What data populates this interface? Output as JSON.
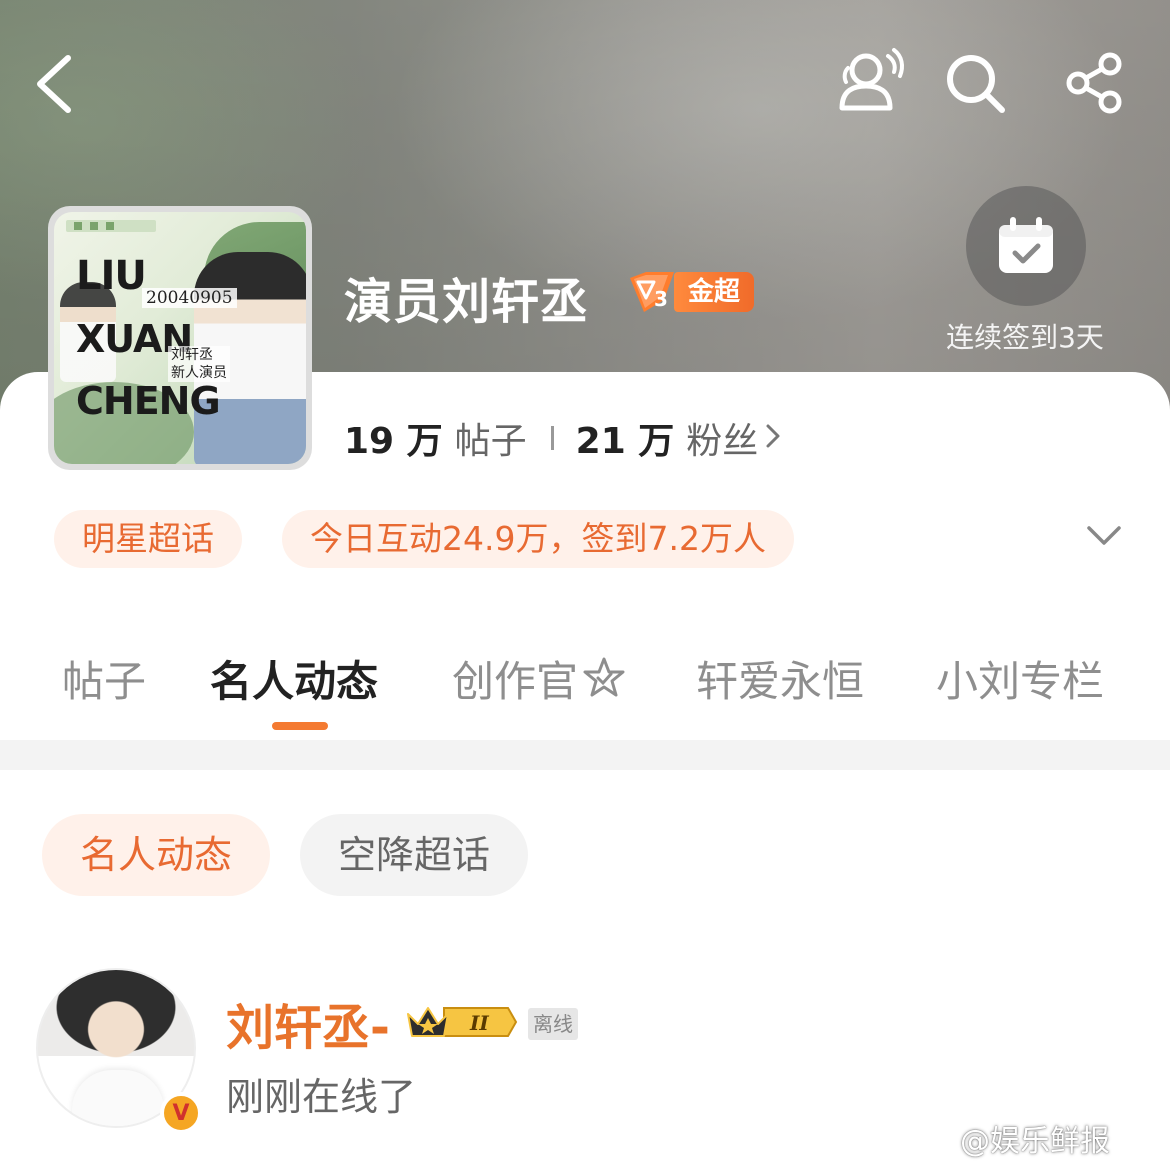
{
  "header": {
    "back_icon": "back-arrow-icon",
    "people_icon": "people-broadcast-icon",
    "search_icon": "search-icon",
    "share_icon": "share-icon"
  },
  "checkin": {
    "icon": "calendar-check-icon",
    "text": "连续签到3天"
  },
  "cover": {
    "line1": "LIU",
    "line2": "XUAN",
    "line3": "CHENG",
    "date": "20040905",
    "sub1": "刘轩丞",
    "sub2": "新人演员"
  },
  "community": {
    "title": "演员刘轩丞",
    "level_number": "3",
    "level_label": "金超",
    "posts_count": "19 万",
    "posts_label": "帖子",
    "fans_count": "21 万",
    "fans_label": "粉丝"
  },
  "chips": {
    "category": "明星超话",
    "activity": "今日互动24.9万，签到7.2万人"
  },
  "tabs": [
    "帖子",
    "名人动态",
    "创作官",
    "轩爱永恒",
    "小刘专栏"
  ],
  "active_tab": "名人动态",
  "subtabs": [
    "名人动态",
    "空降超话"
  ],
  "user": {
    "name": "刘轩丞-",
    "crown_level": "II",
    "status_tag": "离线",
    "status_text": "刚刚在线了"
  },
  "watermark": "@娱乐鲜报",
  "colors": {
    "accent": "#f47a31",
    "chip_bg": "#fff1ea",
    "username": "#e8732b"
  }
}
